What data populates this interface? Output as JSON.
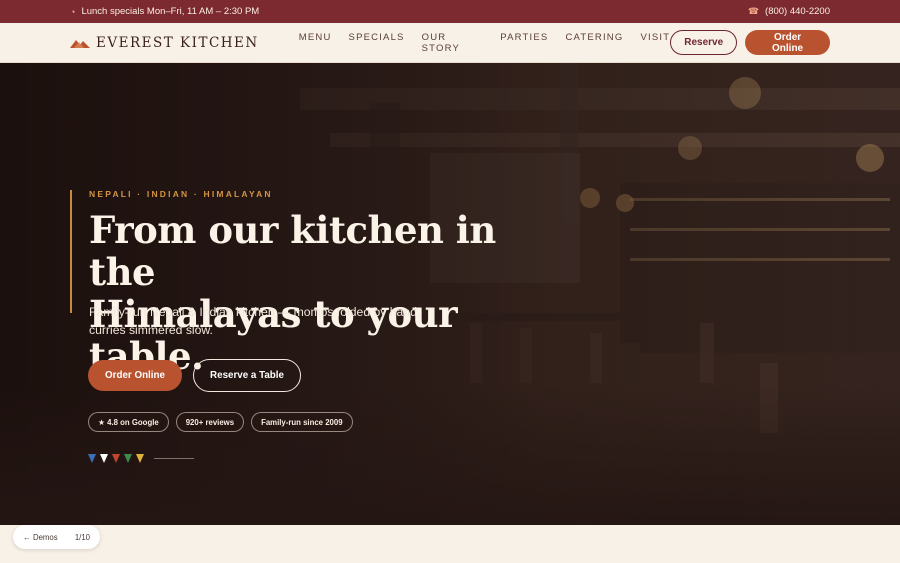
{
  "topbar": {
    "left_icon": "bowl-icon",
    "announcement": "Lunch specials Mon–Fri, 11 AM – 2:30 PM",
    "phone_icon": "phone-icon",
    "phone": "(800) 440-2200"
  },
  "nav": {
    "brand": "EVEREST KITCHEN",
    "menu": [
      "MENU",
      "SPECIALS",
      "OUR STORY",
      "PARTIES",
      "CATERING",
      "VISIT"
    ],
    "reserve_label": "Reserve",
    "order_label": "Order Online"
  },
  "hero": {
    "eyebrow": "NEPALI · INDIAN · HIMALAYAN",
    "headline_line1": "From our kitchen in the",
    "headline_line2": "Himalayas to your table.",
    "subtitle": "Family-run Nepali & Indian kitchen — momos folded by hand, curries simmered slow.",
    "cta_primary": "Order Online",
    "cta_secondary": "Reserve a Table",
    "chips": [
      "★ 4.8 on Google",
      "920+ reviews",
      "Family-run since 2009"
    ],
    "prayer_flag_colors": [
      "#3b6fb6",
      "#ffffff",
      "#c2452f",
      "#3d8a4a",
      "#e0b13a"
    ]
  },
  "demo_nav": {
    "back_label": "← Demos",
    "counter": "1/10"
  },
  "colors": {
    "topbar": "#7c2a2f",
    "accent": "#b9532f",
    "cream": "#f8f1e7",
    "gold": "#d49443"
  }
}
